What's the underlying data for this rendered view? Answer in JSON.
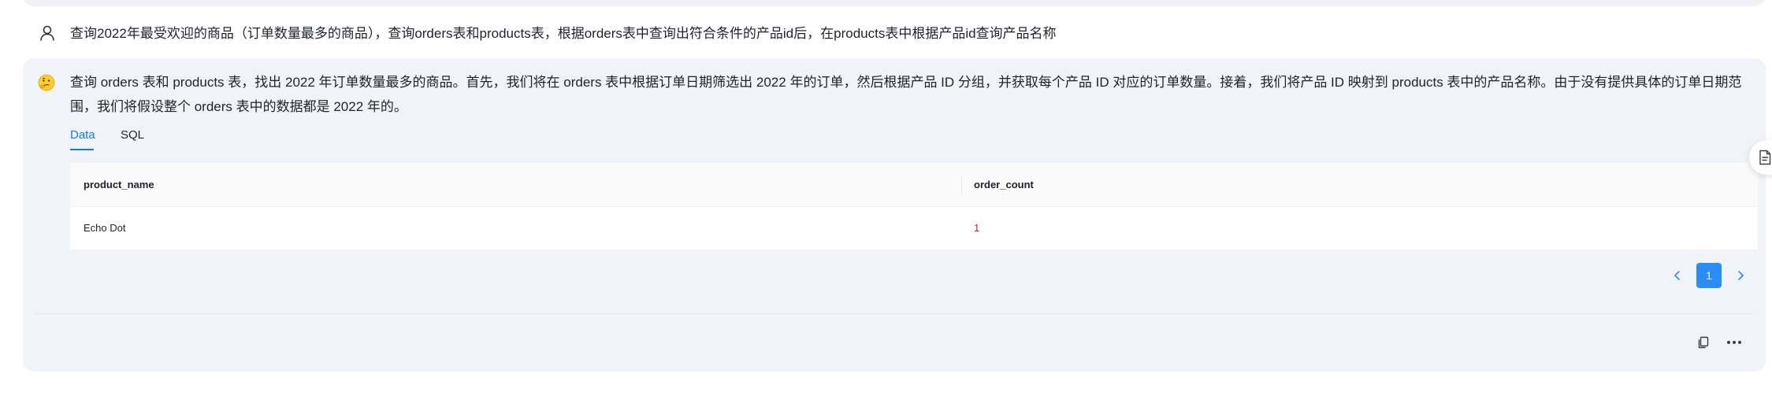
{
  "user_message": {
    "text": "查询2022年最受欢迎的商品（订单数量最多的商品），查询orders表和products表，根据orders表中查询出符合条件的产品id后，在products表中根据产品id查询产品名称",
    "icon": "user-icon"
  },
  "assistant_message": {
    "icon": "thinking-face-emoji-icon",
    "text": "查询 orders 表和 products 表，找出 2022 年订单数量最多的商品。首先，我们将在 orders 表中根据订单日期筛选出 2022 年的订单，然后根据产品 ID 分组，并获取每个产品 ID 对应的订单数量。接着，我们将产品 ID 映射到 products 表中的产品名称。由于没有提供具体的订单日期范围，我们将假设整个 orders 表中的数据都是 2022 年的。",
    "tabs": [
      {
        "label": "Data",
        "active": true
      },
      {
        "label": "SQL",
        "active": false
      }
    ],
    "table": {
      "columns": [
        "product_name",
        "order_count"
      ],
      "rows": [
        [
          "Echo Dot",
          "1"
        ]
      ]
    },
    "pagination": {
      "current_page": "1"
    },
    "actions": {
      "copy_icon": "copy-icon",
      "more_icon": "more-horizontal-icon"
    }
  },
  "side_panel": {
    "icon": "document-icon"
  },
  "colors": {
    "accent": "#1677ff",
    "card_bg": "#f0f3f7",
    "number_value": "#cf1322",
    "pager_active": "#2a8cf5"
  }
}
